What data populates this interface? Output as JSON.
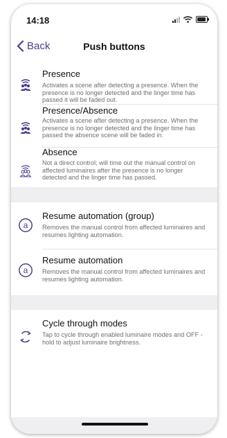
{
  "status_bar": {
    "time": "14:18"
  },
  "nav": {
    "back_label": "Back",
    "title": "Push buttons"
  },
  "sections": [
    {
      "items": [
        {
          "title": "Presence",
          "description": "Activates a scene after detecting a presence. When the presence is no longer detected and the linger time has passed it will be faded out.",
          "icon": "presence-icon"
        },
        {
          "title": "Presence/Absence",
          "description": "Activates a scene after detecting a presence. When the presence is no longer detected and the linger time has passed the absence scene will be faded in.",
          "icon": "presence-absence-icon"
        },
        {
          "title": "Absence",
          "description": "Not a direct control; will time out the manual control on affected luminaires after the presence is no longer detected and the linger time has passed.",
          "icon": "absence-icon"
        }
      ]
    },
    {
      "items": [
        {
          "title": "Resume automation (group)",
          "description": "Removes the manual control from affected luminaires and resumes lighting automation.",
          "icon": "automation-icon"
        },
        {
          "title": "Resume automation",
          "description": "Removes the manual control from affected luminaires and resumes lighting automation.",
          "icon": "automation-icon"
        }
      ]
    },
    {
      "items": [
        {
          "title": "Cycle through modes",
          "description": "Tap to cycle through enabled luminaire modes and OFF - hold to adjust luminaire brightness.",
          "icon": "cycle-arrows-icon"
        }
      ]
    }
  ],
  "colors": {
    "accent": "#4b3d8f",
    "icon": "#4b3d8f",
    "background": "#efeff1",
    "secondary_text": "#6e6e72"
  }
}
